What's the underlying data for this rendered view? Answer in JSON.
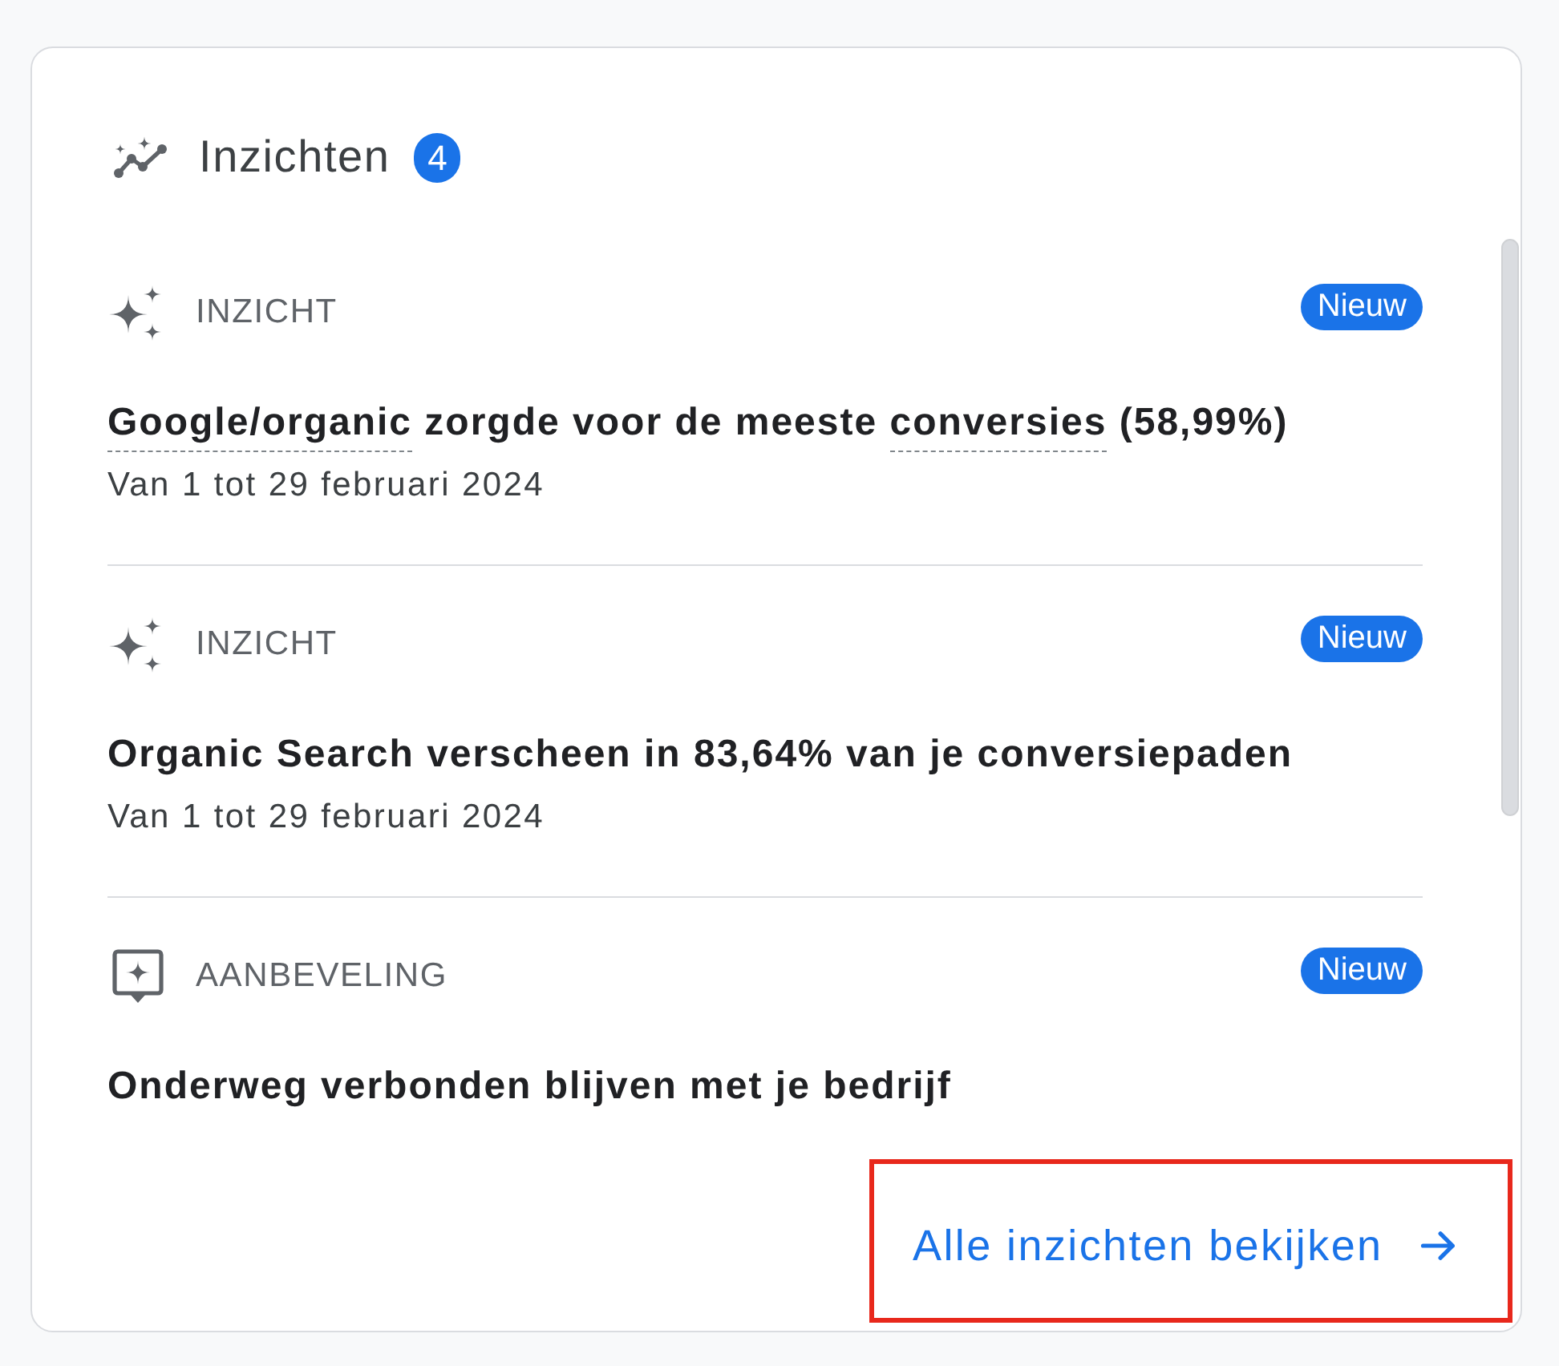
{
  "header": {
    "title": "Inzichten",
    "count": "4"
  },
  "items": [
    {
      "kind": "insight",
      "type_label": "INZICHT",
      "badge": "Nieuw",
      "title_parts": [
        {
          "text": "Google/organic",
          "dashed_underline": true
        },
        {
          "text": " zorgde voor de meeste ",
          "dashed_underline": false
        },
        {
          "text": "conversies",
          "dashed_underline": true
        },
        {
          "text": " (58,99%)",
          "dashed_underline": false
        }
      ],
      "date": "Van 1 tot 29 februari 2024"
    },
    {
      "kind": "insight",
      "type_label": "INZICHT",
      "badge": "Nieuw",
      "title_parts": [
        {
          "text": "Organic Search verscheen in 83,64% van je conversiepaden",
          "dashed_underline": false
        }
      ],
      "date": "Van 1 tot 29 februari 2024"
    },
    {
      "kind": "recommendation",
      "type_label": "AANBEVELING",
      "badge": "Nieuw",
      "title_parts": [
        {
          "text": "Onderweg verbonden blijven met je bedrijf",
          "dashed_underline": false
        }
      ]
    }
  ],
  "footer_link": {
    "label": "Alle inzichten bekijken",
    "highlighted": true
  }
}
